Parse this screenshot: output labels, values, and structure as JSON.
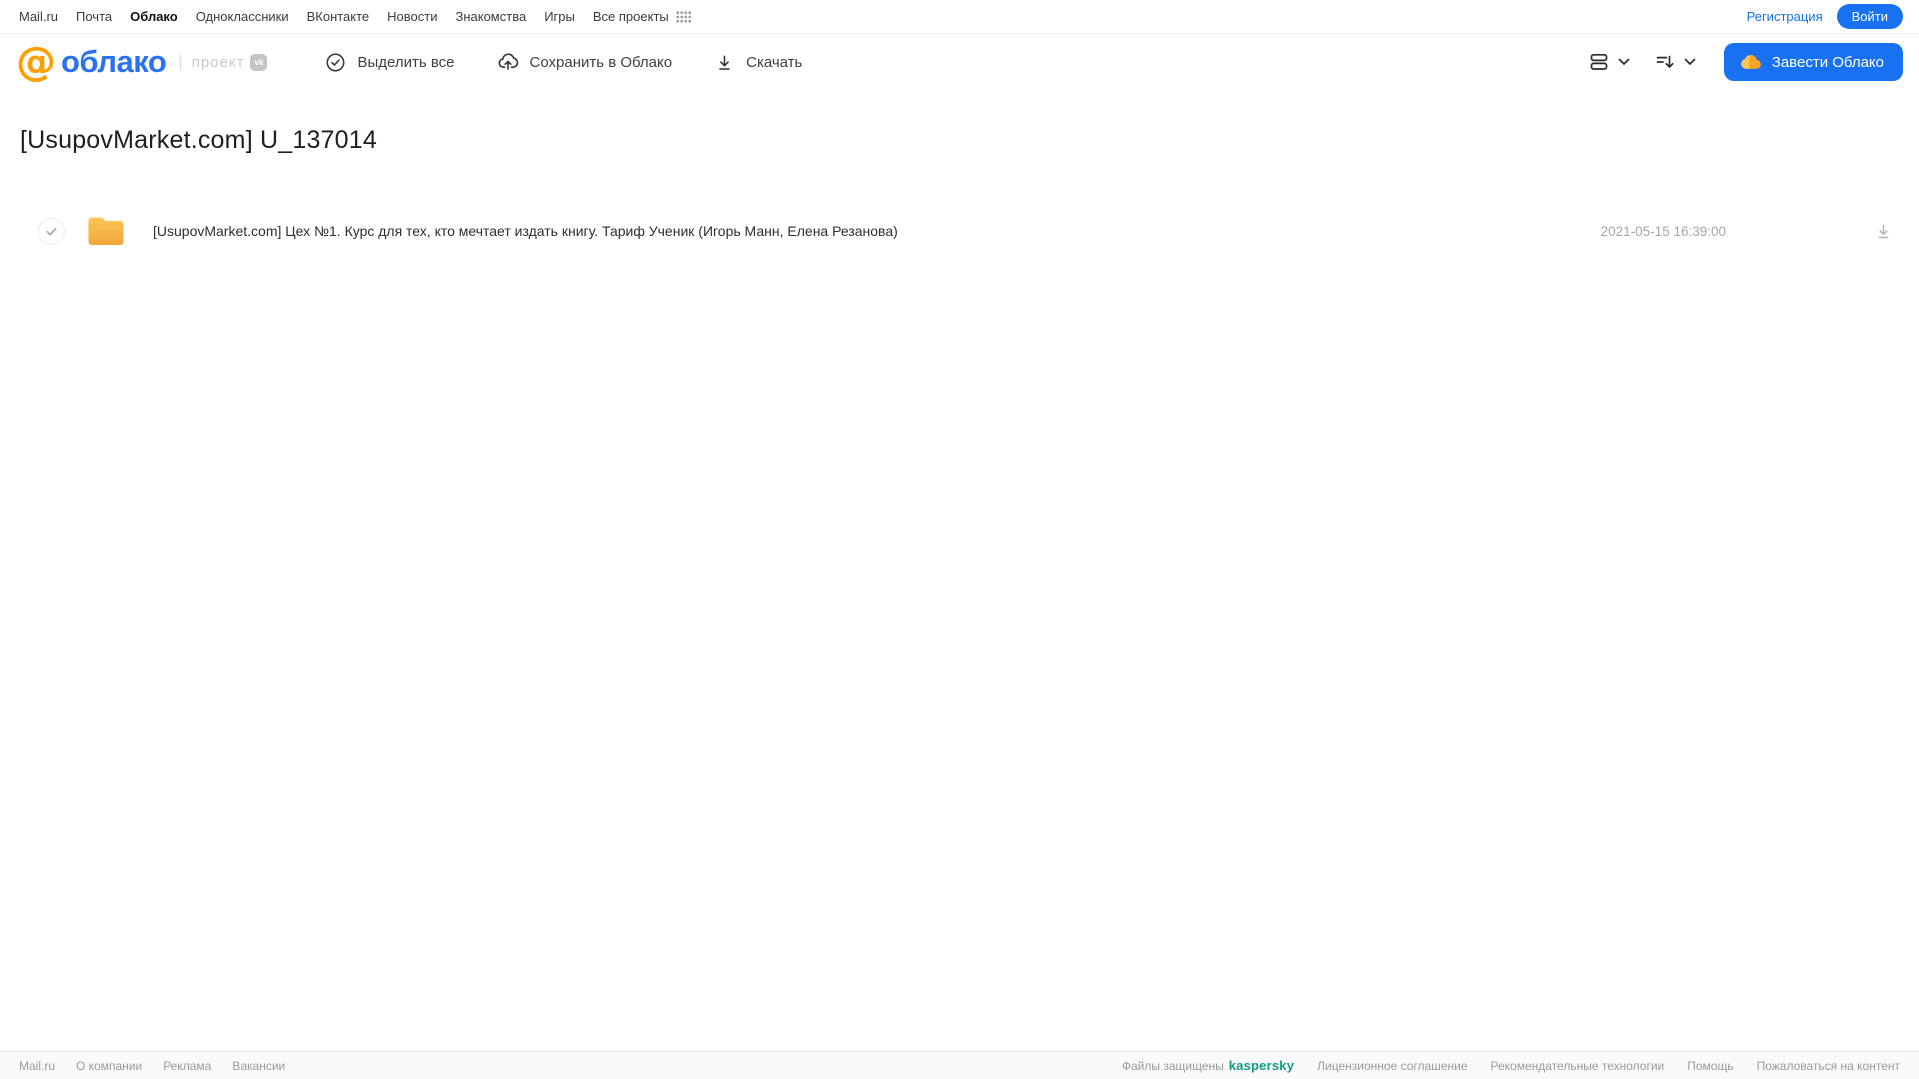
{
  "colors": {
    "accent": "#1771f1",
    "logo_blue": "#2a72f0",
    "orange": "#ff9e00",
    "folder_top": "#ffc658",
    "folder_bottom": "#efa53c",
    "kaspersky": "#0e9b85"
  },
  "topnav": {
    "links": [
      "Mail.ru",
      "Почта",
      "Облако",
      "Одноклассники",
      "ВКонтакте",
      "Новости",
      "Знакомства",
      "Игры",
      "Все проекты"
    ],
    "active_link": "Облако",
    "registration": "Регистрация",
    "login": "Войти"
  },
  "header": {
    "logo": {
      "at": "@",
      "name": "облако",
      "divider": "|",
      "project": "проект",
      "vk": "vk"
    },
    "toolbar": {
      "select_all": "Выделить все",
      "save_to_cloud": "Сохранить в Облако",
      "download": "Скачать"
    },
    "get_cloud_button": "Завести Облако"
  },
  "main": {
    "title": "[UsupovMarket.com] U_137014",
    "files": [
      {
        "type": "folder",
        "name": "[UsupovMarket.com] Цех №1. Курс для тех, кто мечтает издать книгу. Тариф Ученик (Игорь Манн, Елена Резанова)",
        "date": "2021-05-15 16:39:00"
      }
    ]
  },
  "footer": {
    "left_links": [
      "Mail.ru",
      "О компании",
      "Реклама",
      "Вакансии"
    ],
    "protected_label": "Файлы защищены",
    "kaspersky": "kaspersky",
    "right_links": [
      "Лицензионное соглашение",
      "Рекомендательные технологии",
      "Помощь",
      "Пожаловаться на контент"
    ]
  },
  "icons": {
    "apps_grid": "apps-grid-icon",
    "check_circle": "check-circle-icon",
    "cloud_upload": "cloud-upload-icon",
    "download": "download-icon",
    "list_view": "list-view-icon",
    "sort": "sort-icon",
    "chevron_down": "chevron-down-icon",
    "cloud": "cloud-icon",
    "folder": "folder-icon",
    "check": "check-icon",
    "vk": "vk-badge-icon"
  }
}
